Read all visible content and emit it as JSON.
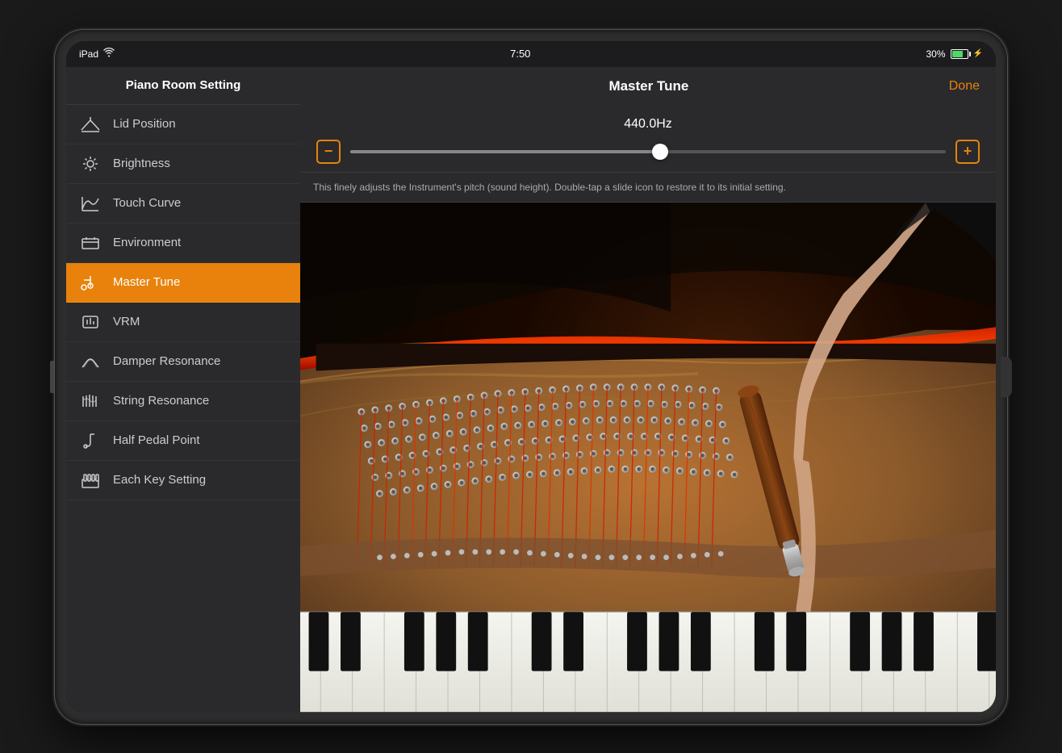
{
  "device": {
    "status_bar": {
      "left": "iPad",
      "time": "7:50",
      "battery_percent": "30%"
    }
  },
  "sidebar": {
    "header": "Piano Room Setting",
    "items": [
      {
        "id": "lid-position",
        "label": "Lid Position",
        "active": false
      },
      {
        "id": "brightness",
        "label": "Brightness",
        "active": false
      },
      {
        "id": "touch-curve",
        "label": "Touch Curve",
        "active": false
      },
      {
        "id": "environment",
        "label": "Environment",
        "active": false
      },
      {
        "id": "master-tune",
        "label": "Master Tune",
        "active": true
      },
      {
        "id": "vrm",
        "label": "VRM",
        "active": false
      },
      {
        "id": "damper-resonance",
        "label": "Damper Resonance",
        "active": false
      },
      {
        "id": "string-resonance",
        "label": "String Resonance",
        "active": false
      },
      {
        "id": "half-pedal-point",
        "label": "Half Pedal Point",
        "active": false
      },
      {
        "id": "each-key-setting",
        "label": "Each Key Setting",
        "active": false
      }
    ]
  },
  "content": {
    "title": "Master Tune",
    "done_button": "Done",
    "tune_value": "440.0Hz",
    "description": "This finely adjusts the Instrument's pitch (sound height). Double-tap a slide icon to restore it to its initial setting.",
    "minus_label": "−",
    "plus_label": "+"
  },
  "colors": {
    "accent": "#e8820c",
    "active_bg": "#e8820c",
    "sidebar_bg": "#2a2a2c",
    "content_bg": "#1c1c1e"
  }
}
